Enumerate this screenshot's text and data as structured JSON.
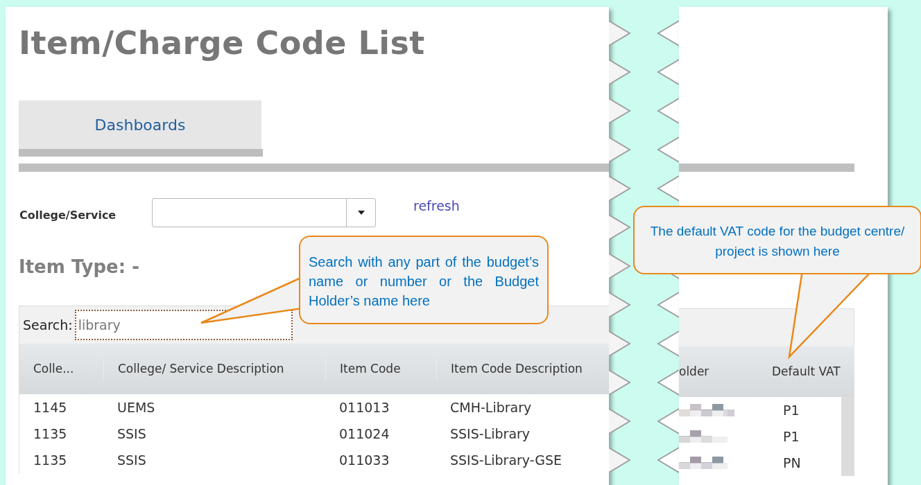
{
  "page": {
    "title": "Item/Charge Code List",
    "tabs": [
      {
        "label": "Dashboards",
        "selected": true
      }
    ],
    "filter": {
      "label": "College/Service",
      "link": "refresh"
    },
    "item_type": "Item Type: -",
    "search": {
      "label": "Search:",
      "value": "library"
    },
    "table": {
      "columns": [
        "Colle...",
        "College/ Service Description",
        "Item Code",
        "Item Code Description"
      ],
      "rows": [
        [
          "1145",
          "UEMS",
          "011013",
          "CMH-Library"
        ],
        [
          "1135",
          "SSIS",
          "011024",
          "SSIS-Library"
        ],
        [
          "1135",
          "SSIS",
          "011033",
          "SSIS-Library-GSE"
        ]
      ]
    }
  },
  "right_page": {
    "table": {
      "columns": [
        "older",
        "Default VAT"
      ],
      "rows": [
        {
          "vat": "P1"
        },
        {
          "vat": "P1"
        },
        {
          "vat": "PN"
        }
      ]
    }
  },
  "callouts": [
    "Search with any part of the budget’s name or number or the Budget Holder’s name here",
    "The default VAT code for the budget centre/ project is shown here"
  ]
}
